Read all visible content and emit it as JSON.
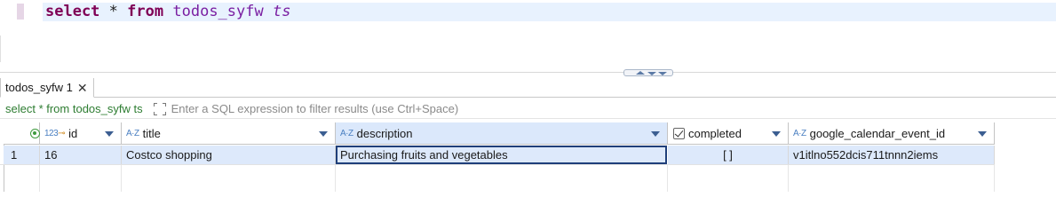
{
  "editor": {
    "sql": {
      "kw_select": "select",
      "star": "*",
      "kw_from": "from",
      "table": "todos_syfw",
      "alias": "ts"
    }
  },
  "results_tab": {
    "label": "todos_syfw 1",
    "close_icon": "close-icon"
  },
  "filter": {
    "query_text": "select * from todos_syfw ts",
    "placeholder": "Enter a SQL expression to filter results (use Ctrl+Space)"
  },
  "grid": {
    "columns": [
      {
        "name": "id",
        "type_icon": "123"
      },
      {
        "name": "title",
        "type_icon": "A-Z"
      },
      {
        "name": "description",
        "type_icon": "A-Z"
      },
      {
        "name": "completed",
        "type_icon": "checkbox"
      },
      {
        "name": "google_calendar_event_id",
        "type_icon": "A-Z"
      }
    ],
    "rows": [
      {
        "row_number": "1",
        "id": "16",
        "title": "Costco shopping",
        "description": "Purchasing fruits and vegetables",
        "completed": "[ ]",
        "google_calendar_event_id": "v1itlno552dcis711tnnn2iems"
      }
    ]
  },
  "colors": {
    "keyword": "#7f0055",
    "identifier": "#7a1fa2",
    "filter_query": "#2e7d32",
    "selection": "#dde9fb",
    "focused_border": "#1f3f7a"
  }
}
